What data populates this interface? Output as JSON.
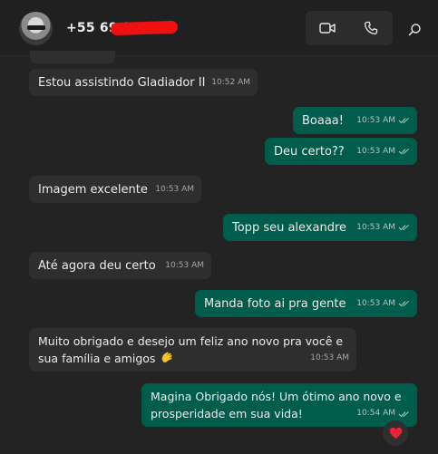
{
  "header": {
    "contact_name": "+55 69 9",
    "video_icon": "video-camera-icon",
    "voice_icon": "phone-icon",
    "search_icon": "search-icon"
  },
  "messages": [
    {
      "direction": "in",
      "text": "Estou assistindo Gladiador II",
      "time": "10:52 AM"
    },
    {
      "direction": "out",
      "text": "Boaaa!",
      "time": "10:53 AM"
    },
    {
      "direction": "out",
      "text": "Deu certo??",
      "time": "10:53 AM"
    },
    {
      "direction": "in",
      "text": "Imagem excelente",
      "time": "10:53 AM"
    },
    {
      "direction": "out",
      "text": "Topp seu alexandre",
      "time": "10:53 AM"
    },
    {
      "direction": "in",
      "text": "Até agora deu certo",
      "time": "10:53 AM"
    },
    {
      "direction": "out",
      "text": "Manda foto ai pra gente",
      "time": "10:53 AM"
    },
    {
      "direction": "in",
      "text_line1": "Muito obrigado e desejo um feliz ano novo pra você e",
      "text_line2": "sua família e amigos",
      "emoji": "clapping-hands",
      "time": "10:53 AM"
    },
    {
      "direction": "out",
      "text_line1": "Magina Obrigado nós! Um ótimo ano novo e",
      "text_line2": "prosperidade em sua vida!",
      "time": "10:54 AM",
      "reaction": "heart"
    }
  ],
  "colors": {
    "background": "#232323",
    "incoming_bubble": "#2e2e2e",
    "outgoing_bubble": "#005c4b",
    "read_ticks": "#a8c7bf"
  }
}
